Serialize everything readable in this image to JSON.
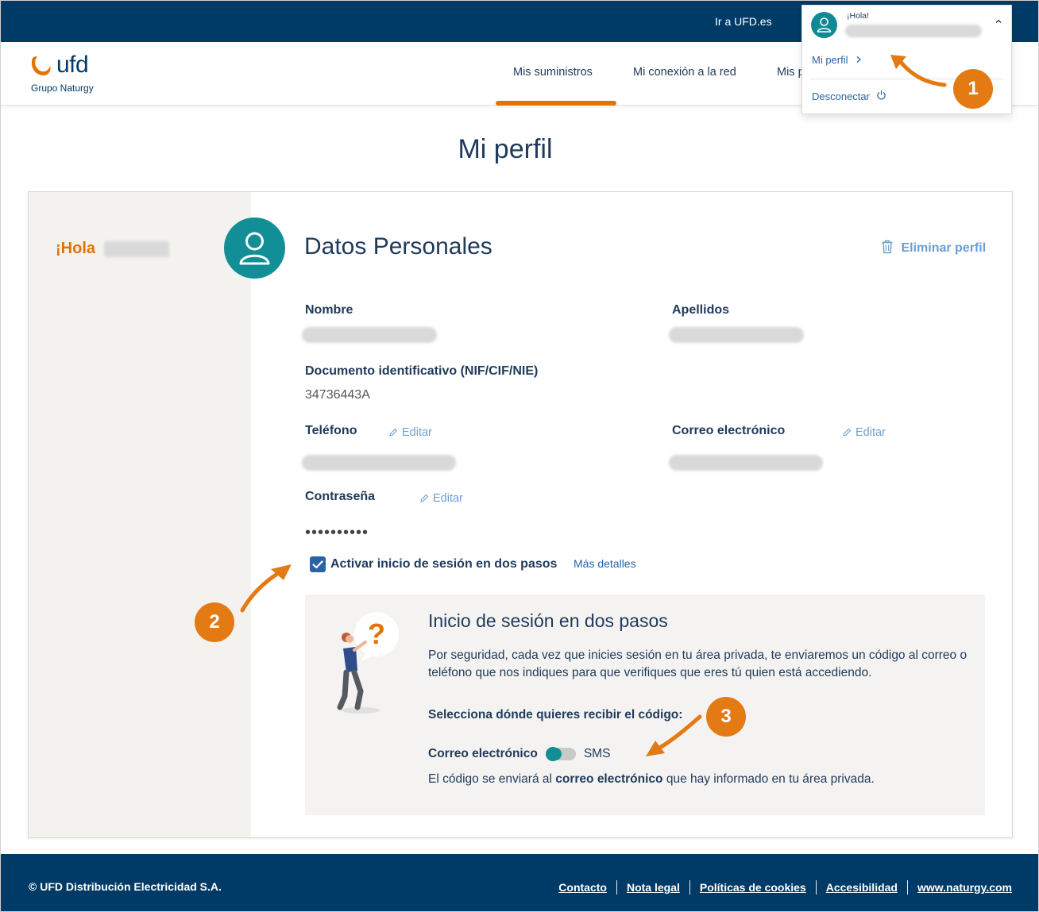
{
  "topbar": {
    "link": "Ir a UFD.es"
  },
  "brand": {
    "name": "ufd",
    "subtitle": "Grupo Naturgy",
    "color": "#e57200",
    "navy": "#003b67"
  },
  "nav": {
    "items": [
      {
        "label": "Mis suministros",
        "active": true
      },
      {
        "label": "Mi conexión a la red",
        "active": false
      },
      {
        "label": "Mis p",
        "active": false
      }
    ]
  },
  "user_menu": {
    "greeting": "¡Hola!",
    "perfil": "Mi perfil",
    "logout": "Desconectar"
  },
  "badges": [
    "1",
    "2",
    "3"
  ],
  "page": {
    "title": "Mi perfil"
  },
  "sidebar": {
    "greeting": "¡Hola"
  },
  "section": {
    "title": "Datos Personales",
    "delete": "Eliminar perfil",
    "fields": {
      "nombre": "Nombre",
      "apellidos": "Apellidos",
      "documento": "Documento identificativo (NIF/CIF/NIE)",
      "documento_value": "34736443A",
      "telefono": "Teléfono",
      "correo": "Correo electrónico",
      "contrasena": "Contraseña",
      "password_mask": "••••••••••",
      "edit_label": "Editar"
    },
    "two_step": {
      "checkbox_label": "Activar inicio de sesión en dos pasos",
      "checked": true,
      "details_link": "Más detalles"
    }
  },
  "two_step_box": {
    "title": "Inicio de sesión en dos pasos",
    "description": "Por seguridad, cada vez que inicies sesión en tu área privada, te enviaremos un código al correo o teléfono que nos indiques para que verifiques que eres tú quien está accediendo.",
    "select_label": "Selecciona dónde quieres recibir el código:",
    "option_email": "Correo electrónico",
    "option_sms": "SMS",
    "selected": "Correo electrónico",
    "note_prefix": "El código se enviará al ",
    "note_bold": "correo electrónico",
    "note_suffix": " que hay informado en tu área privada."
  },
  "footer": {
    "copyright": "© UFD Distribución Electricidad S.A.",
    "links": [
      "Contacto",
      "Nota legal",
      "Políticas de cookies",
      "Accesibilidad",
      "www.naturgy.com"
    ]
  }
}
